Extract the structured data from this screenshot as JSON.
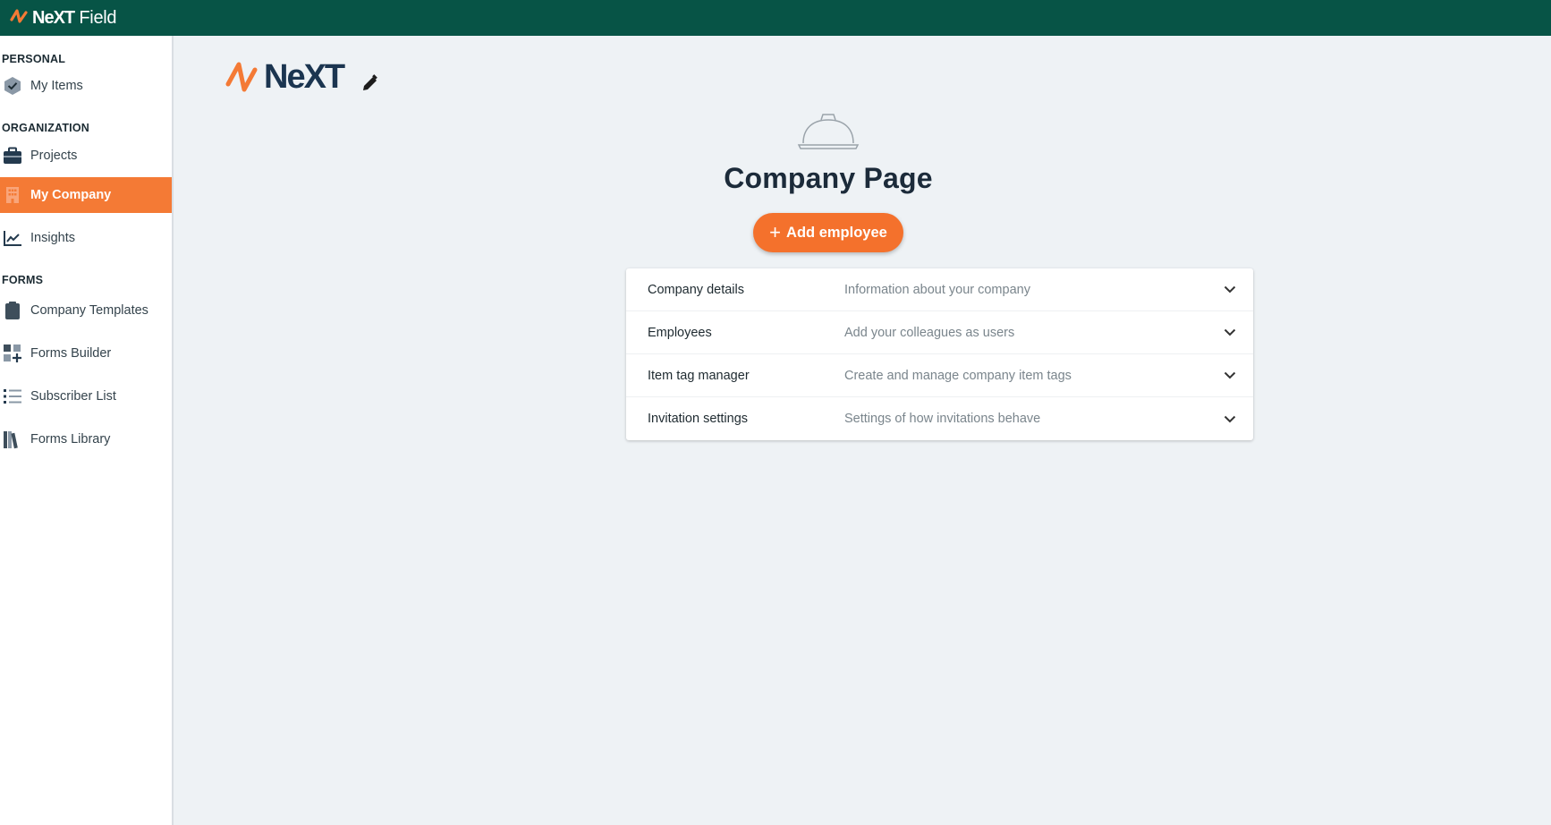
{
  "topbar": {
    "brand_bold": "NeXT",
    "brand_rest": " Field"
  },
  "sidebar": {
    "sections": [
      {
        "title": "PERSONAL"
      },
      {
        "title": "ORGANIZATION"
      },
      {
        "title": "FORMS"
      }
    ],
    "items": [
      {
        "label": "My Items",
        "icon": "check-hexagon-icon"
      },
      {
        "label": "Projects",
        "icon": "briefcase-icon"
      },
      {
        "label": "My Company",
        "icon": "building-icon",
        "active": true
      },
      {
        "label": "Insights",
        "icon": "trending-chart-icon"
      },
      {
        "label": "Company Templates",
        "icon": "clipboard-icon"
      },
      {
        "label": "Forms Builder",
        "icon": "grid-add-icon"
      },
      {
        "label": "Subscriber List",
        "icon": "list-icon"
      },
      {
        "label": "Forms Library",
        "icon": "books-icon"
      }
    ]
  },
  "main": {
    "company_logo_text": "NeXT",
    "page_title": "Company Page",
    "add_button_label": "Add employee",
    "panel_rows": [
      {
        "name": "Company details",
        "description": "Information about your company"
      },
      {
        "name": "Employees",
        "description": "Add your colleagues as users"
      },
      {
        "name": "Item tag manager",
        "description": "Create and manage company item tags"
      },
      {
        "name": "Invitation settings",
        "description": "Settings of how invitations behave"
      }
    ]
  },
  "colors": {
    "topbar": "#075446",
    "accent": "#f47a35",
    "navy": "#1b3550",
    "background": "#eef2f5"
  }
}
